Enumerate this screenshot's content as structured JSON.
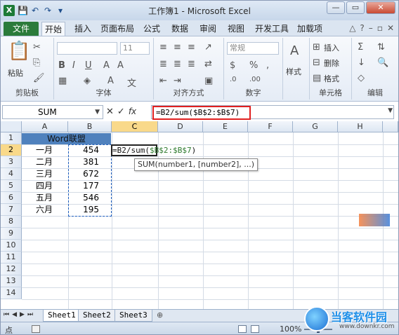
{
  "window": {
    "title": "工作簿1 - Microsoft Excel"
  },
  "quick_access": {
    "icons": [
      "excel-icon",
      "save-icon",
      "undo-icon",
      "redo-icon",
      "customize-icon"
    ]
  },
  "tabs": [
    "文件",
    "开始",
    "插入",
    "页面布局",
    "公式",
    "数据",
    "审阅",
    "视图",
    "开发工具",
    "加载项"
  ],
  "ribbon": {
    "clipboard": {
      "label": "剪贴板",
      "paste": "粘贴"
    },
    "font": {
      "label": "字体",
      "size": "11"
    },
    "alignment": {
      "label": "对齐方式"
    },
    "number": {
      "label": "数字",
      "format": "常规"
    },
    "styles": {
      "label": "样式"
    },
    "cells": {
      "label": "单元格",
      "insert": "插入",
      "delete": "删除",
      "format": "格式"
    },
    "editing": {
      "label": "编辑"
    }
  },
  "formula_bar": {
    "name_box": "SUM",
    "buttons": [
      "✕",
      "✓",
      "fx"
    ],
    "formula": "=B2/sum($B$2:$B$7)"
  },
  "grid": {
    "columns": [
      "A",
      "B",
      "C",
      "D",
      "E",
      "F",
      "G",
      "H"
    ],
    "active_column": "C",
    "rows": [
      "1",
      "2",
      "3",
      "4",
      "5",
      "6",
      "7",
      "8",
      "9",
      "10",
      "11",
      "12",
      "13",
      "14"
    ],
    "active_row": "2",
    "header_b1": "Word联盟",
    "months": [
      "一月",
      "二月",
      "三月",
      "四月",
      "五月",
      "六月"
    ],
    "values": [
      "454",
      "381",
      "672",
      "177",
      "546",
      "195"
    ],
    "edit_formula_pre": "=B2/sum(",
    "edit_formula_range": "$B$2:$B$7",
    "edit_formula_post": ")",
    "tooltip": "SUM(number1, [number2], ...)"
  },
  "sheets": [
    "Sheet1",
    "Sheet2",
    "Sheet3"
  ],
  "active_sheet": "Sheet1",
  "status": {
    "mode": "点",
    "zoom": "100%"
  },
  "watermark": {
    "brand": "当客软件园",
    "url": "www.downkr.com"
  },
  "colors": {
    "accent": "#2b7b3a",
    "header_fill": "#4f81bd",
    "highlight": "#e02020",
    "selected_header": "#f9d98a"
  }
}
